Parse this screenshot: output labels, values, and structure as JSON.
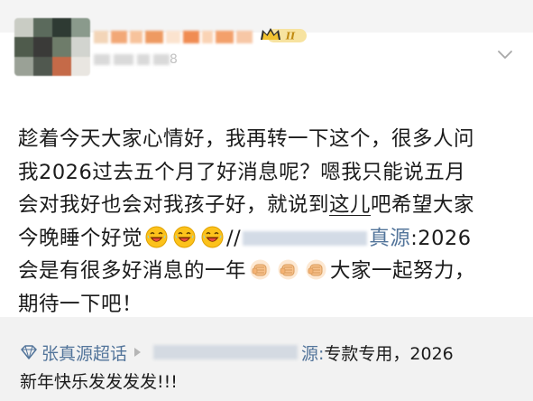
{
  "colors": {
    "link": "#52749a",
    "text": "#1b1b1b",
    "badge_gold": "#e8b400",
    "background_gray": "#f2f2f2"
  },
  "header": {
    "avatar_icon": "blurred-avatar",
    "vip_badge_text": "II",
    "meta_suffix": "8",
    "menu_icon": "chevron-down-icon"
  },
  "post": {
    "line1": "趁着今天大家心情好，我再转一下这个，很多人问",
    "line2": "我2026过去五个月了好消息呢？嗯我只能说五月",
    "line3_a": "会对我好也会对我孩子好，就说到",
    "line3_under": "这儿",
    "line3_b": "吧希望大家",
    "line4_a": "今晚睡个好觉",
    "line4_slashes": "//",
    "line4_link": "真源",
    "line4_b": ":2026",
    "line5_a": "会是有很多好消息的一年",
    "line5_b": "大家一起努力，",
    "line6": "期待一下吧！",
    "emoji_laugh": "laughing-emoji",
    "emoji_fist": "fist-bump-emoji"
  },
  "topic": {
    "icon": "diamond-topic-icon",
    "label": "张真源超话",
    "after_blur": "源:",
    "rest": "专款专用，2026",
    "line2": "新年快乐发发发发!!!"
  }
}
